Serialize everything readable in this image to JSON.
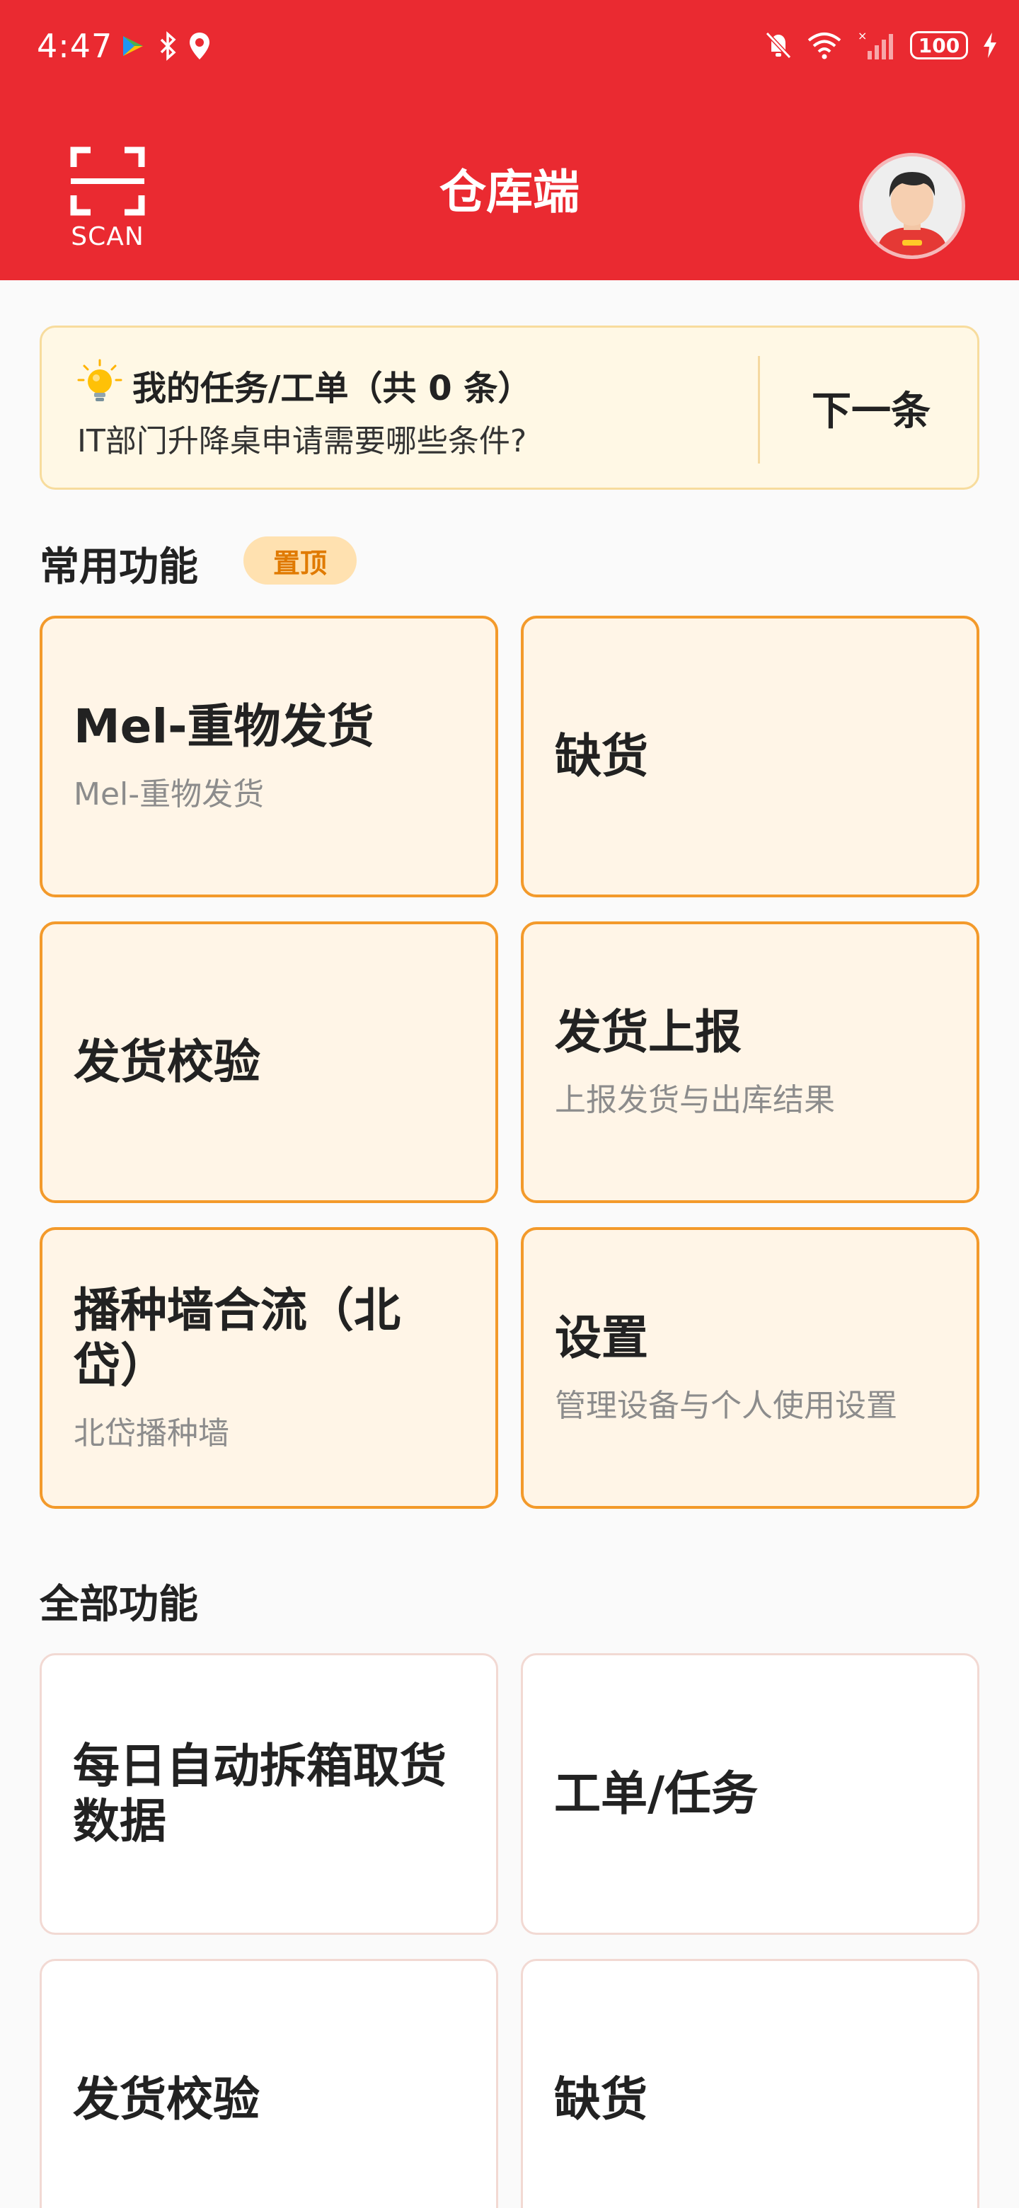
{
  "status_bar": {
    "time": "4:47",
    "battery": "100"
  },
  "header": {
    "scan_label": "SCAN",
    "title": "仓库端",
    "background_color": "#ea2a31"
  },
  "task_banner": {
    "title": "我的任务/工单（共 0 条）",
    "subtitle": "IT部门升降桌申请需要哪些条件?",
    "next_label": "下一条"
  },
  "favorites": {
    "heading": "常用功能",
    "badge": "置顶",
    "tiles": [
      {
        "title": "Mel-重物发货",
        "subtitle": "Mel-重物发货"
      },
      {
        "title": "缺货",
        "subtitle": ""
      },
      {
        "title": "发货校验",
        "subtitle": ""
      },
      {
        "title": "发货上报",
        "subtitle": "上报发货与出库结果"
      },
      {
        "title": "播种墙合流（北岱）",
        "subtitle": "北岱播种墙"
      },
      {
        "title": "设置",
        "subtitle": "管理设备与个人使用设置"
      }
    ]
  },
  "all_functions": {
    "heading": "全部功能",
    "tiles": [
      {
        "title": "每日自动拆箱取货数据",
        "subtitle": ""
      },
      {
        "title": "工单/任务",
        "subtitle": ""
      },
      {
        "title": "发货校验",
        "subtitle": ""
      },
      {
        "title": "缺货",
        "subtitle": ""
      }
    ]
  },
  "icons": {
    "scan": "scan-icon",
    "avatar": "avatar",
    "bulb": "lightbulb-icon"
  }
}
